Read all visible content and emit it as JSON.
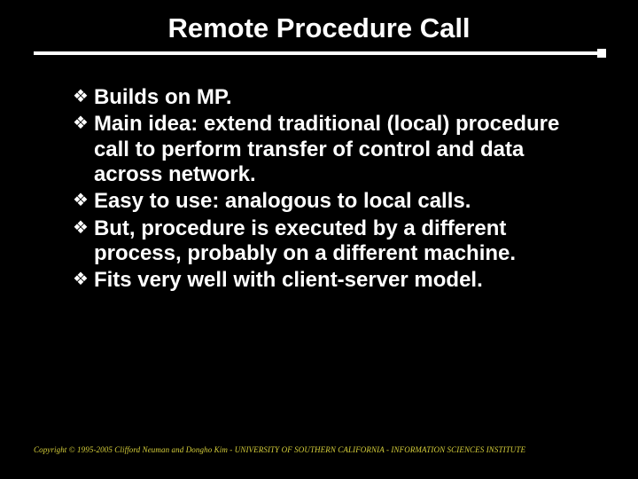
{
  "title": "Remote Procedure Call",
  "bullets": [
    {
      "text": "Builds on MP."
    },
    {
      "text": "Main idea: extend traditional (local) procedure call to perform transfer of control and data across network."
    },
    {
      "text": "Easy to use: analogous to local calls."
    },
    {
      "text": "But, procedure is executed by a different process, probably on a different machine."
    },
    {
      "text": "Fits very well with client-server model."
    }
  ],
  "bullet_glyph": "❖",
  "footer": "Copyright © 1995-2005 Clifford Neuman and Dongho Kim - UNIVERSITY OF SOUTHERN CALIFORNIA - INFORMATION SCIENCES INSTITUTE"
}
